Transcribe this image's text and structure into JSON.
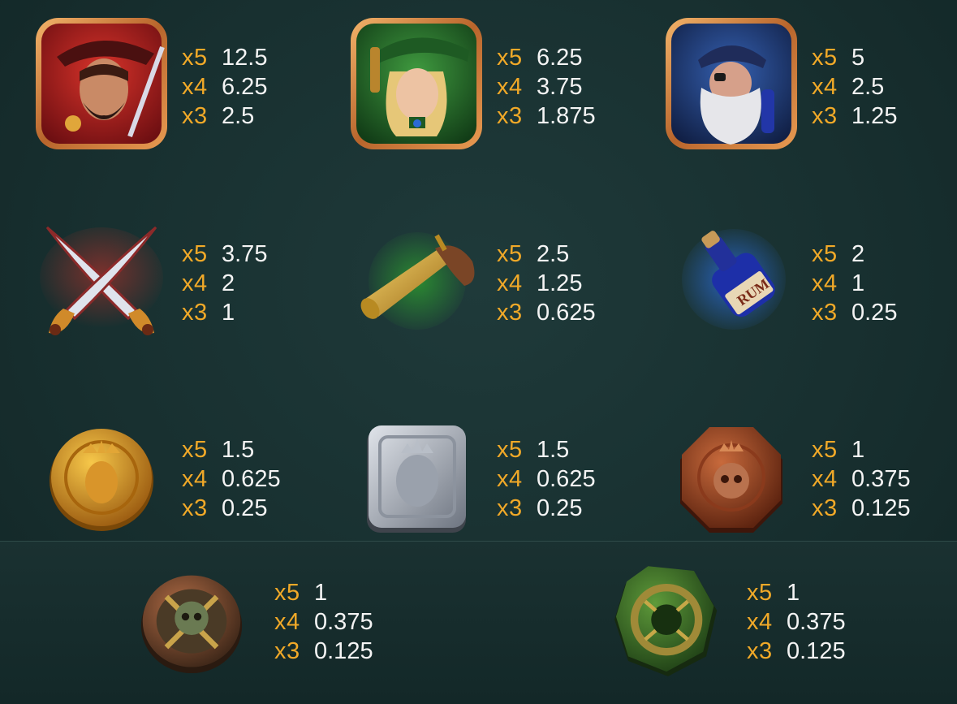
{
  "colors": {
    "multiplier": "#f1a928",
    "value": "#f4f4f4",
    "background": "#183030"
  },
  "symbols": [
    {
      "id": "captain",
      "icon": "pirate-captain-portrait-icon",
      "pays": [
        {
          "mult": "x5",
          "value": "12.5"
        },
        {
          "mult": "x4",
          "value": "6.25"
        },
        {
          "mult": "x3",
          "value": "2.5"
        }
      ]
    },
    {
      "id": "lady",
      "icon": "pirate-lady-portrait-icon",
      "pays": [
        {
          "mult": "x5",
          "value": "6.25"
        },
        {
          "mult": "x4",
          "value": "3.75"
        },
        {
          "mult": "x3",
          "value": "1.875"
        }
      ]
    },
    {
      "id": "oldpirate",
      "icon": "old-pirate-portrait-icon",
      "pays": [
        {
          "mult": "x5",
          "value": "5"
        },
        {
          "mult": "x4",
          "value": "2.5"
        },
        {
          "mult": "x3",
          "value": "1.25"
        }
      ]
    },
    {
      "id": "swords",
      "icon": "crossed-swords-icon",
      "pays": [
        {
          "mult": "x5",
          "value": "3.75"
        },
        {
          "mult": "x4",
          "value": "2"
        },
        {
          "mult": "x3",
          "value": "1"
        }
      ]
    },
    {
      "id": "pistol",
      "icon": "flintlock-pistol-icon",
      "pays": [
        {
          "mult": "x5",
          "value": "2.5"
        },
        {
          "mult": "x4",
          "value": "1.25"
        },
        {
          "mult": "x3",
          "value": "0.625"
        }
      ]
    },
    {
      "id": "rum",
      "icon": "rum-bottle-icon",
      "pays": [
        {
          "mult": "x5",
          "value": "2"
        },
        {
          "mult": "x4",
          "value": "1"
        },
        {
          "mult": "x3",
          "value": "0.25"
        }
      ]
    },
    {
      "id": "goldcoin",
      "icon": "gold-coin-icon",
      "pays": [
        {
          "mult": "x5",
          "value": "1.5"
        },
        {
          "mult": "x4",
          "value": "0.625"
        },
        {
          "mult": "x3",
          "value": "0.25"
        }
      ]
    },
    {
      "id": "silvercoin",
      "icon": "silver-king-coin-icon",
      "pays": [
        {
          "mult": "x5",
          "value": "1.5"
        },
        {
          "mult": "x4",
          "value": "0.625"
        },
        {
          "mult": "x3",
          "value": "0.25"
        }
      ]
    },
    {
      "id": "coppercoin",
      "icon": "copper-skull-coin-icon",
      "pays": [
        {
          "mult": "x5",
          "value": "1"
        },
        {
          "mult": "x4",
          "value": "0.375"
        },
        {
          "mult": "x3",
          "value": "0.125"
        }
      ]
    },
    {
      "id": "skullcoin",
      "icon": "skull-crossbones-coin-icon",
      "pays": [
        {
          "mult": "x5",
          "value": "1"
        },
        {
          "mult": "x4",
          "value": "0.375"
        },
        {
          "mult": "x3",
          "value": "0.125"
        }
      ]
    },
    {
      "id": "jadecoin",
      "icon": "jade-ring-coin-icon",
      "pays": [
        {
          "mult": "x5",
          "value": "1"
        },
        {
          "mult": "x4",
          "value": "0.375"
        },
        {
          "mult": "x3",
          "value": "0.125"
        }
      ]
    }
  ]
}
